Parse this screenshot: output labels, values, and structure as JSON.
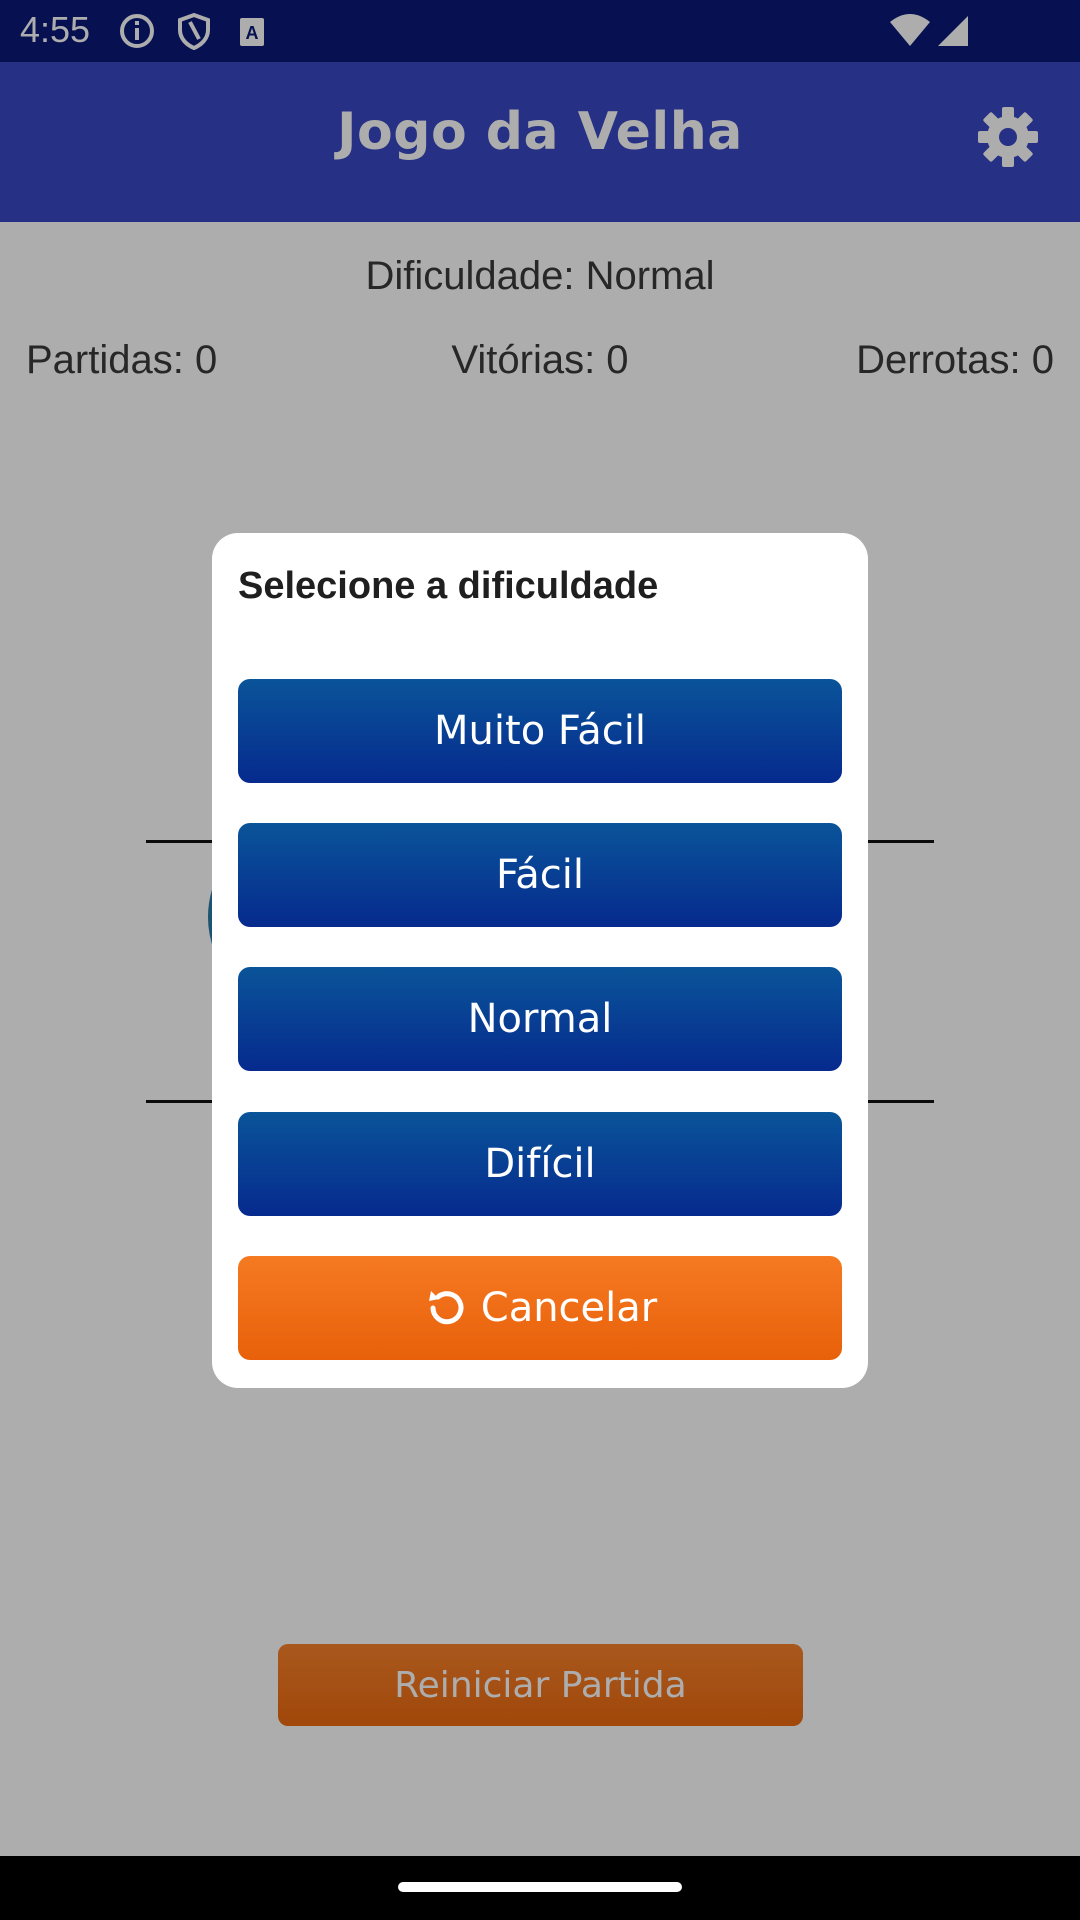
{
  "status_bar": {
    "time": "4:55",
    "icons": [
      "info-icon",
      "shield-icon",
      "keyboard-a-icon",
      "wifi-icon",
      "signal-icon"
    ]
  },
  "app_bar": {
    "title": "Jogo da Velha",
    "settings_icon": "gear-icon"
  },
  "game": {
    "difficulty": "Dificuldade: Normal",
    "stats": {
      "games": "Partidas: 0",
      "wins": "Vitórias: 0",
      "losses": "Derrotas: 0"
    },
    "reset_label": "Reiniciar Partida"
  },
  "dialog": {
    "title": "Selecione a dificuldade",
    "options": [
      "Muito Fácil",
      "Fácil",
      "Normal",
      "Difícil"
    ],
    "cancel_label": "Cancelar",
    "cancel_icon": "refresh-icon"
  },
  "colors": {
    "app_bar": "#3848c4",
    "status_bar": "#0b1a78",
    "option_button": "#0a4a96",
    "cancel_button": "#f27218",
    "reset_button": "#f07a22"
  }
}
